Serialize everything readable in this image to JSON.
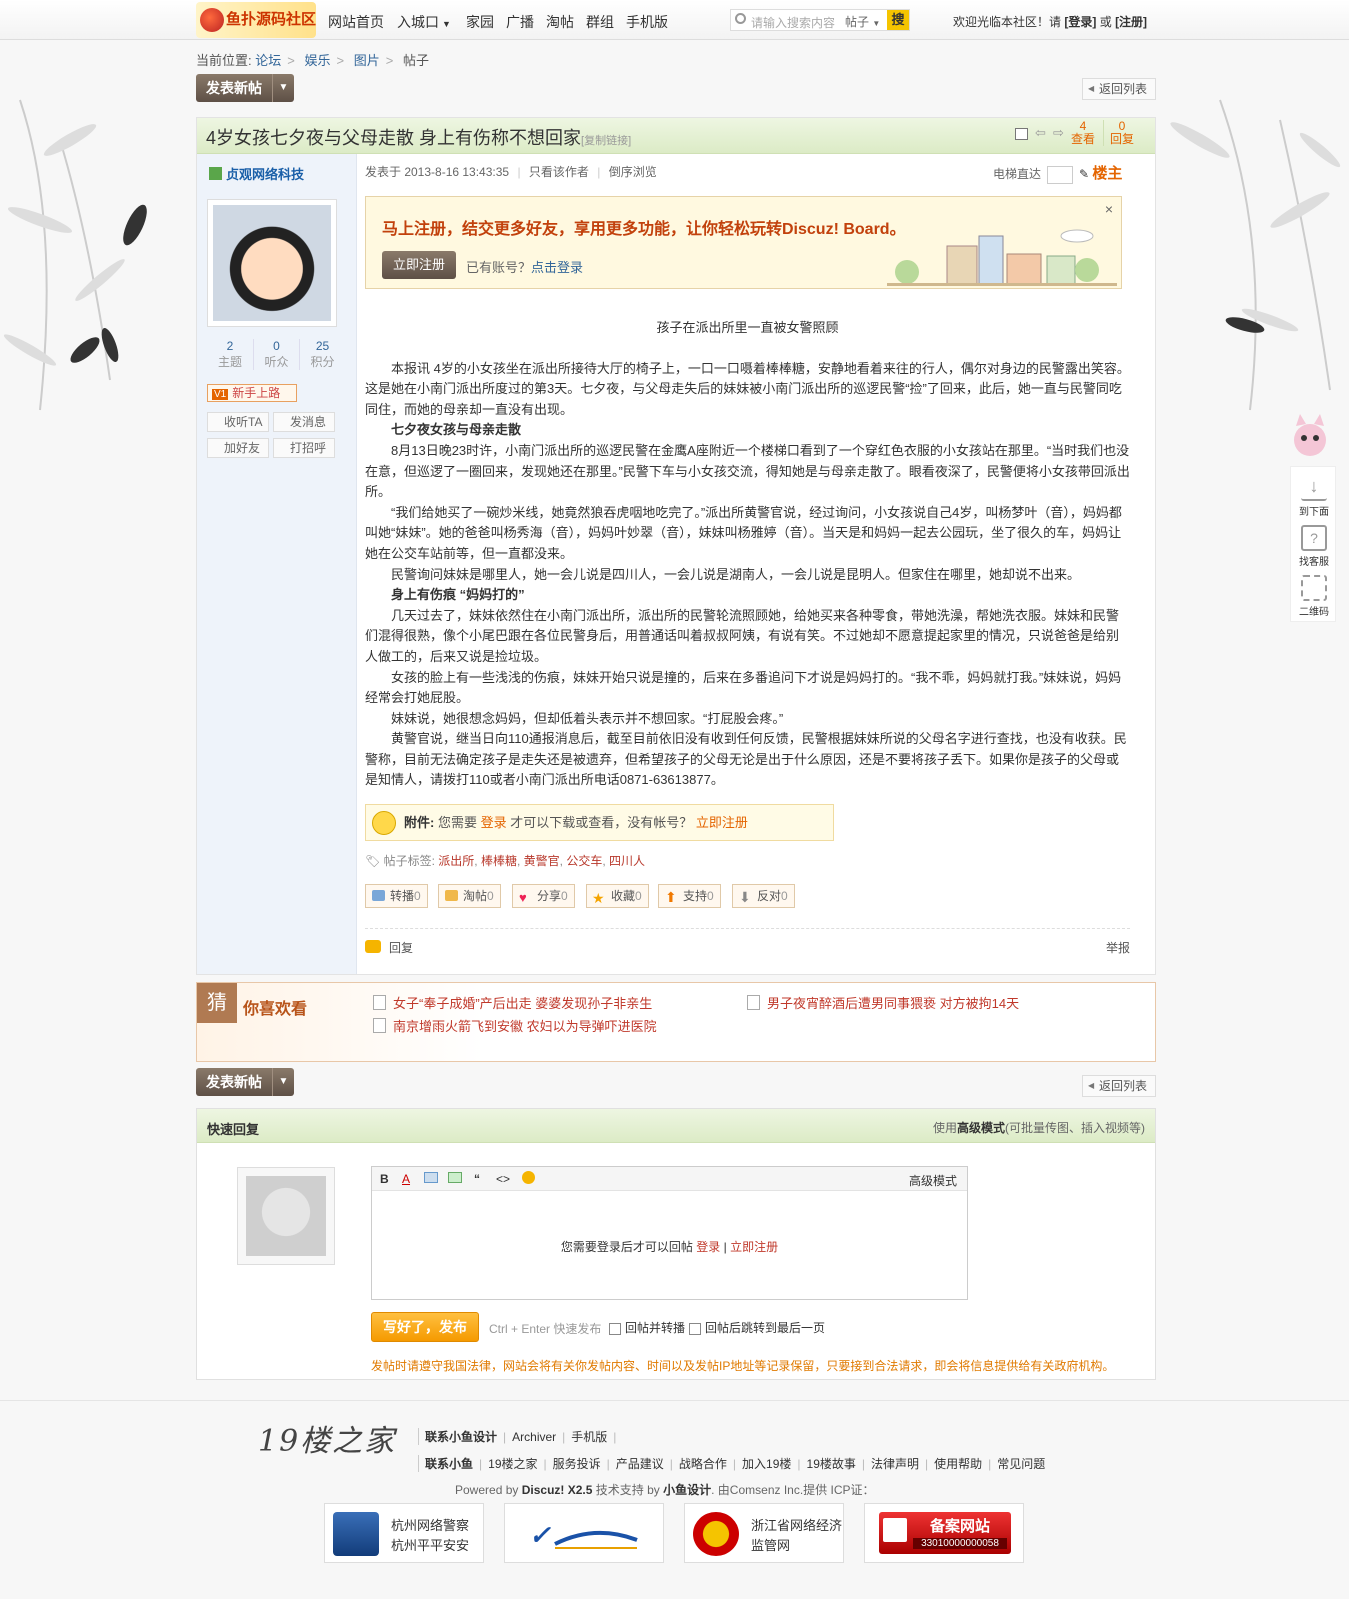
{
  "header": {
    "logo_text": "鱼扑源码社区",
    "nav": [
      "网站首页",
      "入城口",
      "家园",
      "广播",
      "淘帖",
      "群组",
      "手机版"
    ],
    "search_placeholder": "请输入搜索内容",
    "search_scope": "帖子",
    "search_button": "搜",
    "welcome": "欢迎光临本社区！请",
    "login": "[登录]",
    "or": "或",
    "register": "[注册]"
  },
  "breadcrumb": {
    "label": "当前位置:",
    "items": [
      "论坛",
      "娱乐",
      "图片",
      "帖子"
    ]
  },
  "buttons": {
    "new_post": "发表新帖",
    "back_list": "返回列表"
  },
  "thread": {
    "title": "4岁女孩七夕夜与父母走散 身上有伤称不想回家",
    "copy_link": "[复制链接]",
    "views": "4",
    "views_label": "查看",
    "replies": "0",
    "replies_label": "回复"
  },
  "author": {
    "name": "贞观网络科技",
    "stats": [
      {
        "value": "2",
        "label": "主题"
      },
      {
        "value": "0",
        "label": "听众"
      },
      {
        "value": "25",
        "label": "积分"
      }
    ],
    "rank": "新手上路",
    "rank_badge": "V1",
    "actions": [
      "收听TA",
      "发消息",
      "加好友",
      "打招呼"
    ]
  },
  "post": {
    "posted": "发表于 2013-8-16 13:43:35",
    "only_author": "只看该作者",
    "reverse": "倒序浏览",
    "floor_jump": "电梯直达",
    "floor_label": "楼主"
  },
  "reg_banner": {
    "text": "马上注册，结交更多好友，享用更多功能，让你轻松玩转Discuz! Board。",
    "button": "立即注册",
    "have_account": "已有账号？",
    "login_link": "点击登录",
    "close": "×"
  },
  "content": {
    "caption": "孩子在派出所里一直被女警照顾",
    "paragraphs": [
      {
        "bold": false,
        "text": "本报讯 4岁的小女孩坐在派出所接待大厅的椅子上，一口一口嗫着棒棒糖，安静地看着来往的行人，偶尔对身边的民警露出笑容。这是她在小南门派出所度过的第3天。七夕夜，与父母走失后的妹妹被小南门派出所的巡逻民警“捡”了回来，此后，她一直与民警同吃同住，而她的母亲却一直没有出现。"
      },
      {
        "bold": true,
        "text": "七夕夜女孩与母亲走散"
      },
      {
        "bold": false,
        "text": "8月13日晚23时许，小南门派出所的巡逻民警在金鹰A座附近一个楼梯口看到了一个穿红色衣服的小女孩站在那里。“当时我们也没在意，但巡逻了一圈回来，发现她还在那里。”民警下车与小女孩交流，得知她是与母亲走散了。眼看夜深了，民警便将小女孩带回派出所。"
      },
      {
        "bold": false,
        "text": "“我们给她买了一碗炒米线，她竟然狼吞虎咽地吃完了。”派出所黄警官说，经过询问，小女孩说自己4岁，叫杨梦叶（音），妈妈都叫她“妹妹”。她的爸爸叫杨秀海（音），妈妈叶妙翠（音），妹妹叫杨雅婷（音）。当天是和妈妈一起去公园玩，坐了很久的车，妈妈让她在公交车站前等，但一直都没来。"
      },
      {
        "bold": false,
        "text": "民警询问妹妹是哪里人，她一会儿说是四川人，一会儿说是湖南人，一会儿说是昆明人。但家住在哪里，她却说不出来。"
      },
      {
        "bold": true,
        "text": "身上有伤痕 “妈妈打的”"
      },
      {
        "bold": false,
        "text": "几天过去了，妹妹依然住在小南门派出所，派出所的民警轮流照顾她，给她买来各种零食，带她洗澡，帮她洗衣服。妹妹和民警们混得很熟，像个小尾巴跟在各位民警身后，用普通话叫着叔叔阿姨，有说有笑。不过她却不愿意提起家里的情况，只说爸爸是给别人做工的，后来又说是捡垃圾。"
      },
      {
        "bold": false,
        "text": "女孩的脸上有一些浅浅的伤痕，妹妹开始只说是撞的，后来在多番追问下才说是妈妈打的。“我不乖，妈妈就打我。”妹妹说，妈妈经常会打她屁股。"
      },
      {
        "bold": false,
        "text": "妹妹说，她很想念妈妈，但却低着头表示并不想回家。“打屁股会疼。”"
      },
      {
        "bold": false,
        "text": "黄警官说，继当日向110通报消息后，截至目前依旧没有收到任何反馈，民警根据妹妹所说的父母名字进行查找，也没有收获。民警称，目前无法确定孩子是走失还是被遗弃，但希望孩子的父母无论是出于什么原因，还是不要将孩子丢下。如果你是孩子的父母或是知情人，请拨打110或者小南门派出所电话0871-63613877。"
      }
    ]
  },
  "attachment": {
    "label": "附件:",
    "text1": "您需要",
    "login": "登录",
    "text2": "才可以下载或查看，没有帐号？",
    "register": "立即注册"
  },
  "tags": {
    "label": "帖子标签:",
    "items": [
      "派出所",
      "棒棒糖",
      "黄警官",
      "公交车",
      "四川人"
    ]
  },
  "post_actions": [
    {
      "label": "转播",
      "count": "0"
    },
    {
      "label": "淘帖",
      "count": "0"
    },
    {
      "label": "分享",
      "count": "0"
    },
    {
      "label": "收藏",
      "count": "0"
    },
    {
      "label": "支持",
      "count": "0"
    },
    {
      "label": "反对",
      "count": "0"
    }
  ],
  "reply_row": {
    "reply": "回复",
    "report": "举报"
  },
  "guess": {
    "badge": "猜",
    "title": "你喜欢看",
    "links": [
      "女子“奉子成婚”产后出走 婆婆发现孙子非亲生",
      "男子夜宵醉酒后遭男同事猥亵 对方被拘14天",
      "南京增雨火箭飞到安徽 农妇以为导弹吓进医院"
    ]
  },
  "quick_reply": {
    "title": "快速回复",
    "mode_prefix": "使用",
    "mode": "高级模式",
    "mode_suffix": "(可批量传图、插入视频等)",
    "editor_adv": "高级模式",
    "login_msg": "您需要登录后才可以回帖",
    "login": "登录",
    "sep": "|",
    "register": "立即注册",
    "submit": "写好了，发布",
    "hint": "Ctrl + Enter 快速发布",
    "check1": "回帖并转播",
    "check2": "回帖后跳转到最后一页",
    "notice": "发帖时请遵守我国法律，网站会将有关你发帖内容、时间以及发帖IP地址等记录保留，只要接到合法请求，即会将信息提供给有关政府机构。"
  },
  "footer": {
    "logo": "19楼之家",
    "line1": [
      "联系小鱼设计",
      "Archiver",
      "手机版"
    ],
    "line2": [
      "联系小鱼",
      "19楼之家",
      "服务投诉",
      "产品建议",
      "战略合作",
      "加入19楼",
      "19楼故事",
      "法律声明",
      "使用帮助",
      "常见问题"
    ],
    "powered_prefix": "Powered by",
    "powered_name": "Discuz! X2.5",
    "support": "技术支持 by",
    "support_name": "小鱼设计",
    "icp": ". 由Comsenz Inc.提供 ICP证：",
    "badges": [
      {
        "line1": "杭州网络警察",
        "line2": "杭州平平安安"
      },
      {
        "line1": "",
        "line2": ""
      },
      {
        "line1": "浙江省网络经济",
        "line2": "监管网"
      },
      {
        "line1": "备案网站",
        "line2": "33010000000058"
      }
    ]
  },
  "side_tools": [
    "到下面",
    "找客服",
    "二维码"
  ],
  "colors": {
    "accent": "#e46400",
    "link": "#336699",
    "title_bar": "#dcebc6",
    "brown_button": "#5e5046"
  }
}
